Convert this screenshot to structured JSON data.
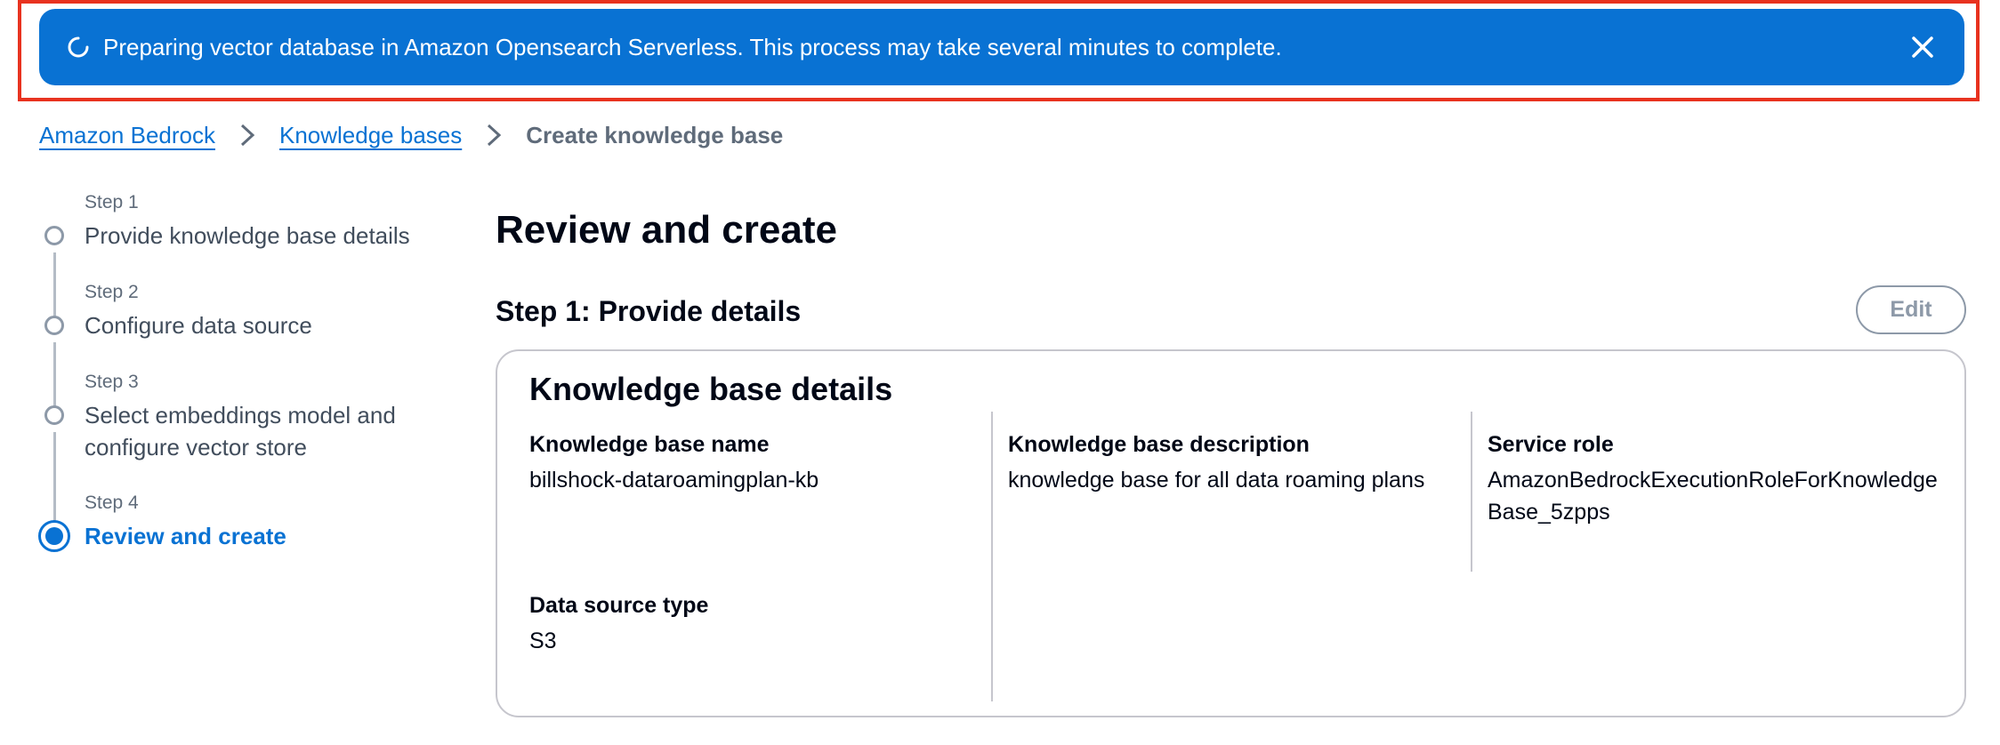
{
  "banner": {
    "message": "Preparing vector database in Amazon Opensearch Serverless. This process may take several minutes to complete.",
    "icon": "spinner-icon",
    "close_icon": "close-icon",
    "color": "#0972d3"
  },
  "breadcrumb": {
    "items": [
      "Amazon Bedrock",
      "Knowledge bases"
    ],
    "current": "Create knowledge base"
  },
  "stepper": {
    "steps": [
      {
        "number": "Step 1",
        "title": "Provide knowledge base details"
      },
      {
        "number": "Step 2",
        "title": "Configure data source"
      },
      {
        "number": "Step 3",
        "title": "Select embeddings model and configure vector store"
      },
      {
        "number": "Step 4",
        "title": "Review and create"
      }
    ],
    "active_step": 4
  },
  "main": {
    "page_title": "Review and create",
    "section_title": "Step 1: Provide details",
    "edit_label": "Edit",
    "card": {
      "title": "Knowledge base details",
      "fields": [
        {
          "label": "Knowledge base name",
          "value": "billshock-dataroamingplan-kb"
        },
        {
          "label": "Knowledge base description",
          "value": "knowledge base for all data roaming plans"
        },
        {
          "label": "Service role",
          "value": "AmazonBedrockExecutionRoleForKnowledgeBase_5zpps"
        },
        {
          "label": "Data source type",
          "value": "S3"
        }
      ]
    }
  },
  "colors": {
    "accent": "#0972d3",
    "highlight": "#e8321f"
  }
}
